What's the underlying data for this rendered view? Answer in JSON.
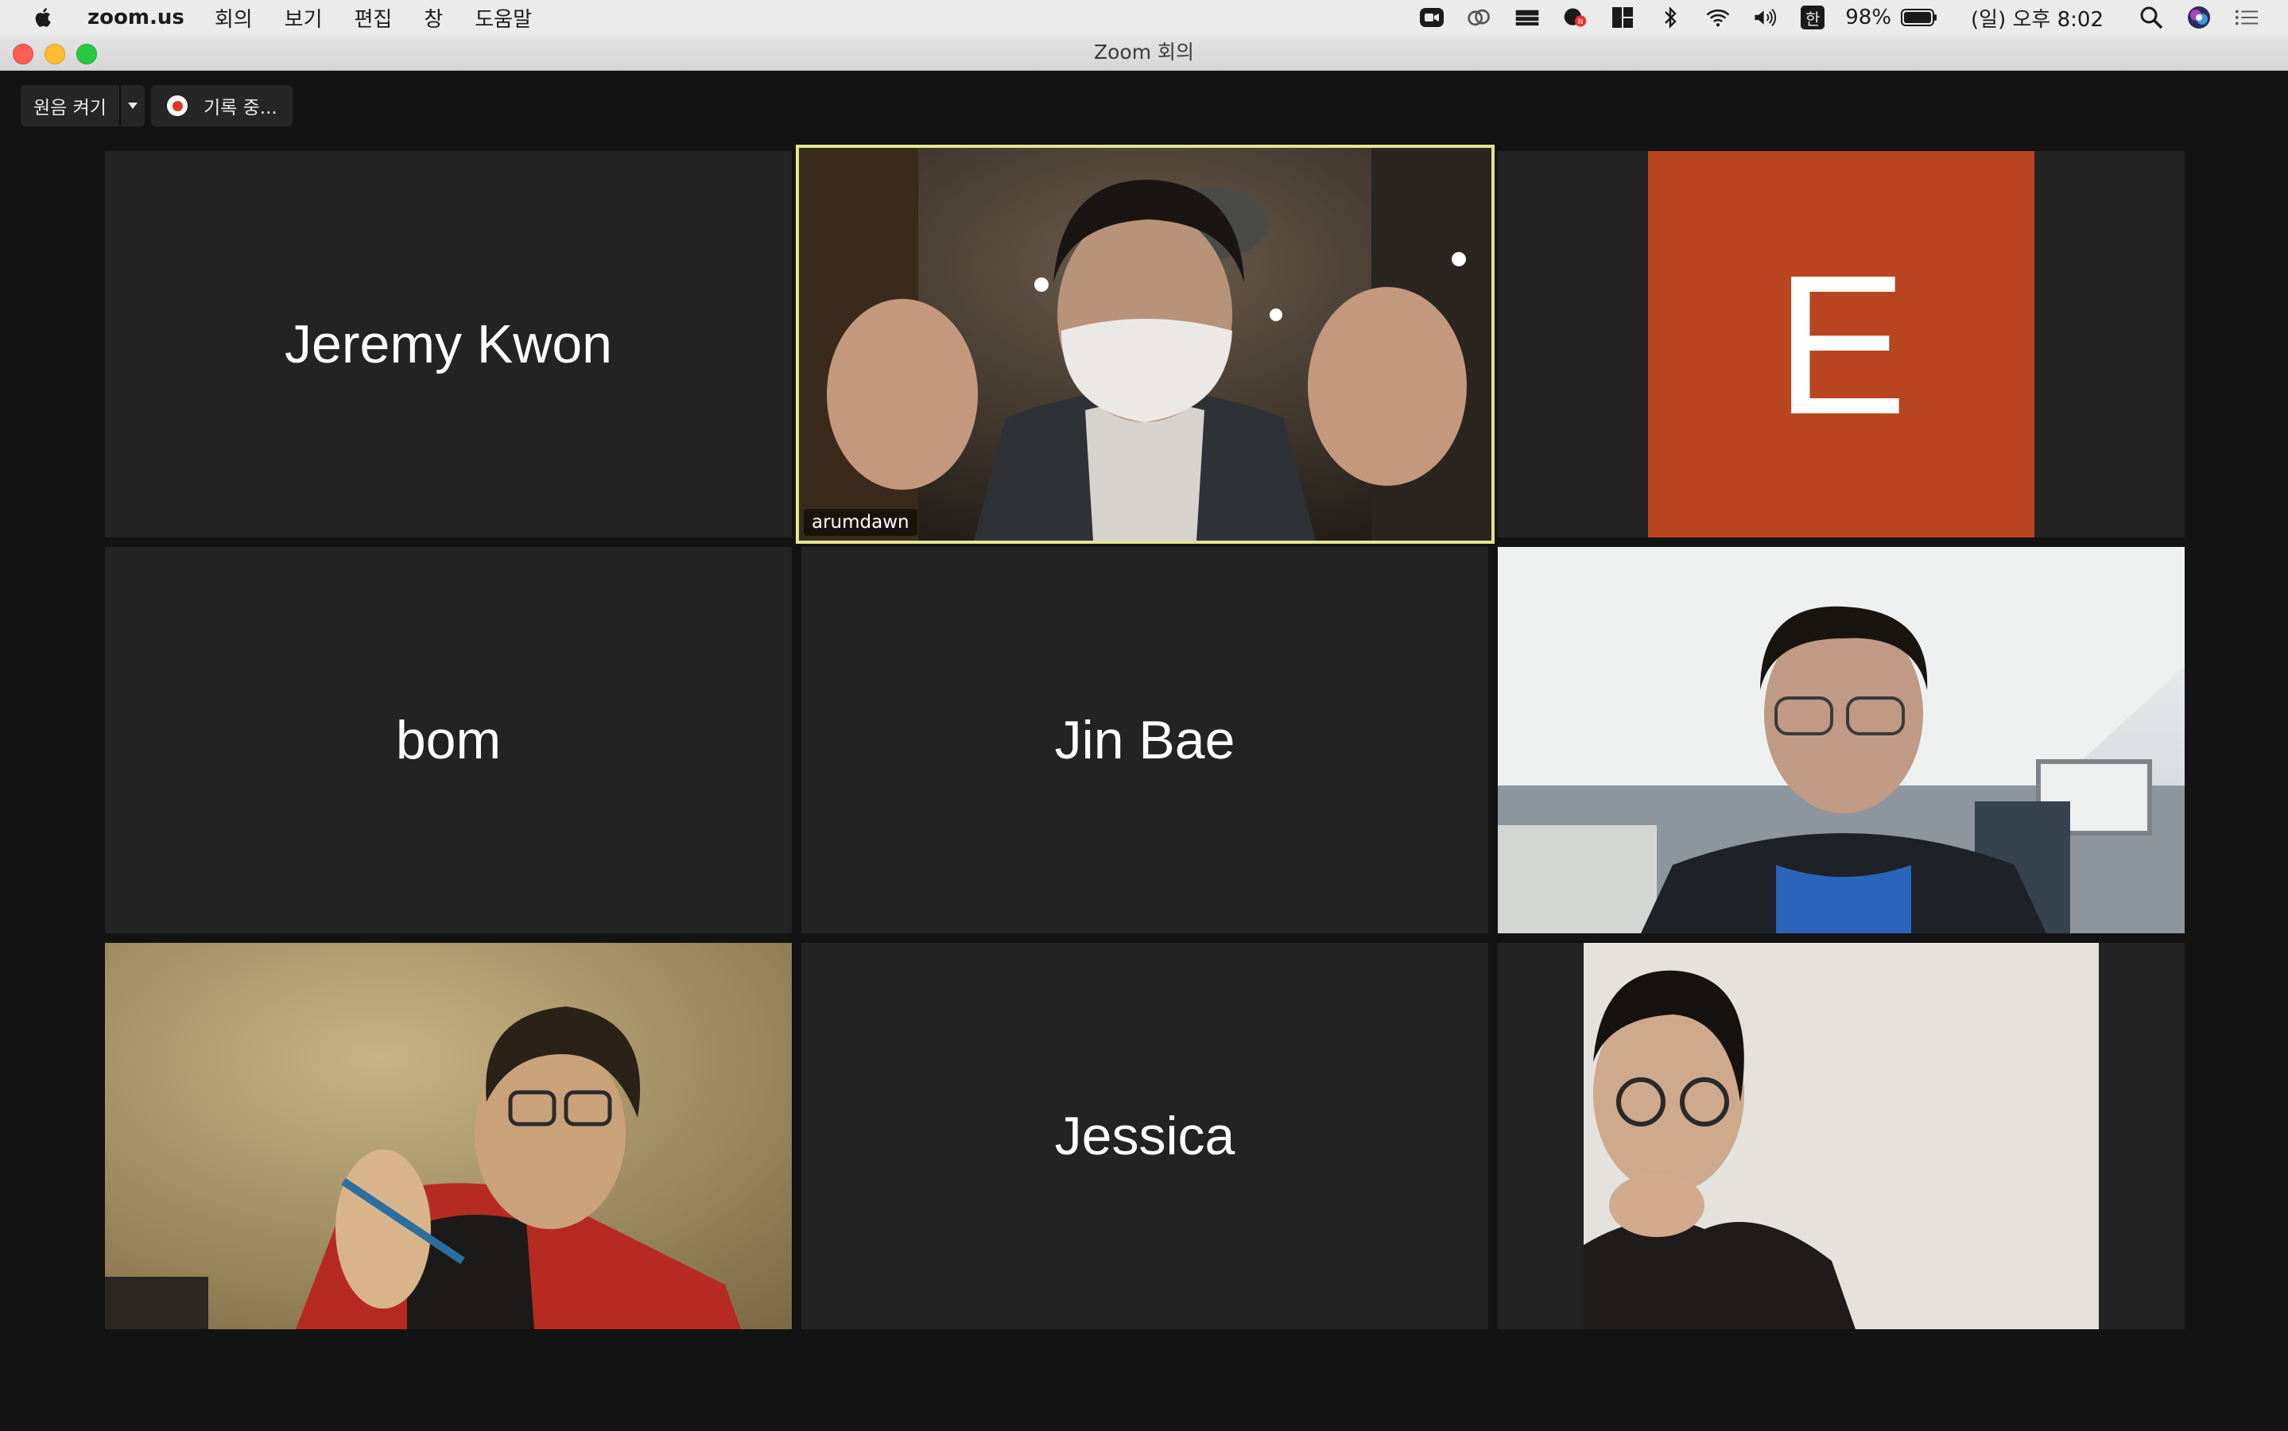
{
  "menubar": {
    "app_name": "zoom.us",
    "menus": [
      "회의",
      "보기",
      "편집",
      "창",
      "도움말"
    ],
    "status": {
      "battery": "98%",
      "input_method": "한",
      "clock": "(일) 오후 8:02"
    },
    "icons": [
      "zoom-icon",
      "creative-cloud-icon",
      "drive-icon",
      "chat-icon",
      "layout-icon",
      "bluetooth-icon",
      "wifi-icon",
      "volume-icon",
      "battery-icon",
      "spotlight-search-icon",
      "siri-icon",
      "control-center-icon"
    ]
  },
  "window": {
    "title": "Zoom 회의"
  },
  "controls": {
    "original_sound": "원음 켜기",
    "recording": "기록 중..."
  },
  "participants": [
    {
      "name": "Jeremy Kwon",
      "video": false
    },
    {
      "name": "arumdawn",
      "video": true,
      "active_speaker": true
    },
    {
      "name": "E",
      "video": false,
      "avatar": true
    },
    {
      "name": "bom",
      "video": false
    },
    {
      "name": "Jin Bae",
      "video": false
    },
    {
      "name": "",
      "video": true
    },
    {
      "name": "",
      "video": true
    },
    {
      "name": "Jessica",
      "video": false
    },
    {
      "name": "",
      "video": true
    }
  ],
  "colors": {
    "active_border": "#e1e58f",
    "avatar_bg": "#b94520",
    "tile_bg": "#232323",
    "window_bg": "#131313"
  }
}
